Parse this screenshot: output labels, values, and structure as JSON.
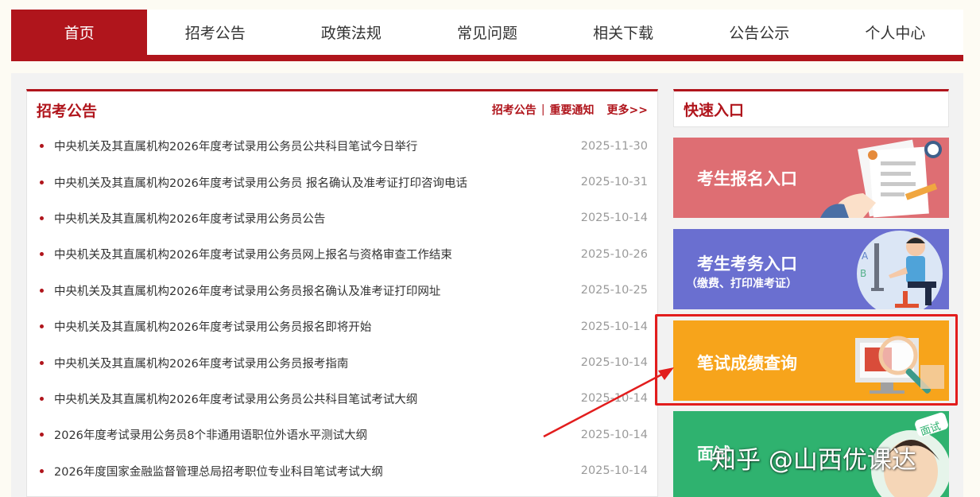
{
  "nav": {
    "items": [
      {
        "label": "首页",
        "active": true
      },
      {
        "label": "招考公告",
        "active": false
      },
      {
        "label": "政策法规",
        "active": false
      },
      {
        "label": "常见问题",
        "active": false
      },
      {
        "label": "相关下载",
        "active": false
      },
      {
        "label": "公告公示",
        "active": false
      },
      {
        "label": "个人中心",
        "active": false
      }
    ]
  },
  "announcements": {
    "title": "招考公告",
    "link_announcements": "招考公告",
    "separator": "|",
    "link_notices": "重要通知",
    "link_more": "更多>>",
    "items": [
      {
        "title": "中央机关及其直属机构2026年度考试录用公务员公共科目笔试今日举行",
        "date": "2025-11-30"
      },
      {
        "title": "中央机关及其直属机构2026年度考试录用公务员 报名确认及准考证打印咨询电话",
        "date": "2025-10-31"
      },
      {
        "title": "中央机关及其直属机构2026年度考试录用公务员公告",
        "date": "2025-10-14"
      },
      {
        "title": "中央机关及其直属机构2026年度考试录用公务员网上报名与资格审查工作结束",
        "date": "2025-10-26"
      },
      {
        "title": "中央机关及其直属机构2026年度考试录用公务员报名确认及准考证打印网址",
        "date": "2025-10-25"
      },
      {
        "title": "中央机关及其直属机构2026年度考试录用公务员报名即将开始",
        "date": "2025-10-14"
      },
      {
        "title": "中央机关及其直属机构2026年度考试录用公务员报考指南",
        "date": "2025-10-14"
      },
      {
        "title": "中央机关及其直属机构2026年度考试录用公务员公共科目笔试考试大纲",
        "date": "2025-10-14"
      },
      {
        "title": "2026年度考试录用公务员8个非通用语职位外语水平测试大纲",
        "date": "2025-10-14"
      },
      {
        "title": "2026年度国家金融监督管理总局招考职位专业科目笔试考试大纲",
        "date": "2025-10-14"
      }
    ]
  },
  "quick": {
    "title": "快速入口",
    "registration": "考生报名入口",
    "affairs": "考生考务入口",
    "affairs_sub": "（缴费、打印准考证）",
    "score": "笔试成绩查询",
    "interview": "面试",
    "interview_badge": "面试"
  },
  "watermark": "知乎 @山西优课达",
  "colors": {
    "brand": "#b0151c",
    "highlight": "#e21d1d",
    "registration": "#de6e73",
    "affairs": "#6a6fd0",
    "score": "#f7a41b",
    "interview": "#2fb26f"
  }
}
